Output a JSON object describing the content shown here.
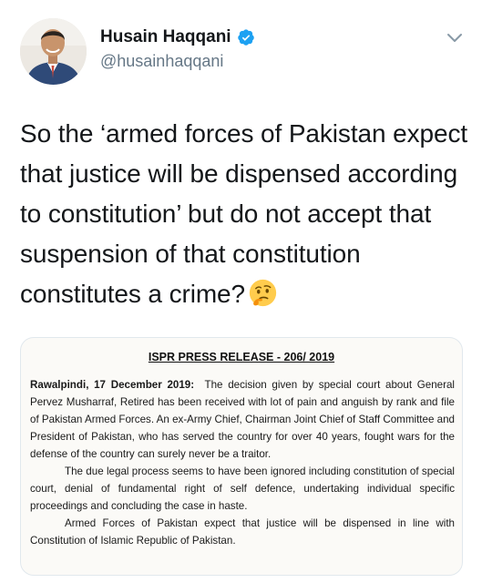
{
  "tweet": {
    "author": {
      "display_name": "Husain Haqqani",
      "handle": "@husainhaqqani",
      "verified": true
    },
    "text": "So the ‘armed forces of Pakistan expect that justice will be dispensed according to constitution’ but do not accept that suspension of that constitution constitutes a crime?",
    "emoji": "thinking-face",
    "colors": {
      "verified_blue": "#1da1f2",
      "text": "#14171a",
      "secondary": "#657786",
      "border": "#e1e8ed"
    }
  },
  "media": {
    "title": "ISPR PRESS RELEASE - 206/ 2019",
    "dateline": "Rawalpindi, 17 December 2019:",
    "paragraph1": "The decision given by special court about General Pervez Musharraf, Retired has been received with lot of pain and anguish by rank and file of Pakistan Armed Forces. An ex-Army Chief, Chairman Joint Chief of Staff Committee and President of Pakistan, who has served the country for over 40 years, fought wars for the defense of the country can surely never be a traitor.",
    "paragraph2": "The due legal process seems to have been ignored including constitution of special court, denial of fundamental right of self defence, undertaking individual specific proceedings and concluding the case in haste.",
    "paragraph3": "Armed Forces of Pakistan expect that justice will be dispensed in line with Constitution of Islamic Republic of Pakistan."
  }
}
